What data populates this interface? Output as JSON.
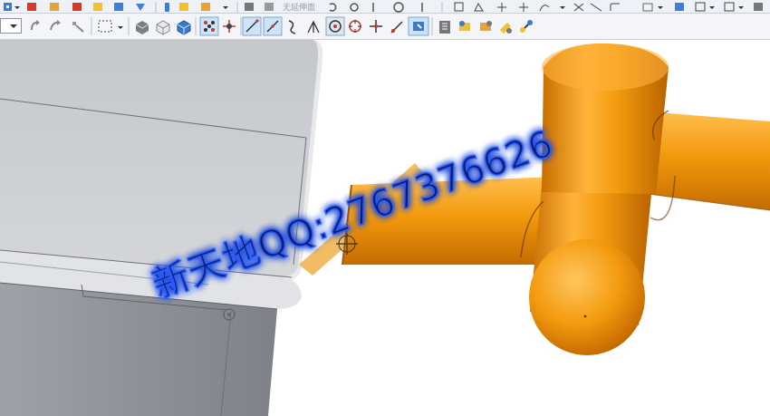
{
  "app": {
    "type": "3d-cad-modeling-window"
  },
  "toolbar_top": {
    "partial_label": "无延伸面",
    "icons": [
      "tree-icon",
      "part-icon",
      "sketch-icon",
      "cube-icon",
      "arrow-icon",
      "cut-icon",
      "draft-icon",
      "mirror-icon",
      "face-icon",
      "line-icon",
      "arc-icon",
      "move-icon",
      "curve-icon"
    ]
  },
  "toolbar_main": {
    "combo_value": "",
    "icons": [
      "rotate-icon",
      "pan-icon",
      "zoom-icon",
      "selection-box-icon",
      "shaded-view-icon",
      "wireframe-view-icon",
      "shaded-edges-icon",
      "snap-point-icon",
      "snap-grid-icon",
      "line-snap-icon",
      "tangent-snap-icon",
      "curve-snap-icon",
      "perpendicular-icon",
      "center-snap-icon",
      "circle-snap-icon",
      "intersection-icon",
      "endpoint-icon",
      "quick-pick-icon",
      "layer-icon",
      "filter-icon",
      "settings-icon",
      "color-icon",
      "tool-icon"
    ]
  },
  "watermark": {
    "text": "新天地QQ:2767376626"
  },
  "colors": {
    "pipe": "#f39a0e",
    "pipe_dark": "#c96f00",
    "plastic_body": "#c9cbcf",
    "plastic_dark": "#8d9096",
    "watermark_glow": "#2a5cff"
  }
}
